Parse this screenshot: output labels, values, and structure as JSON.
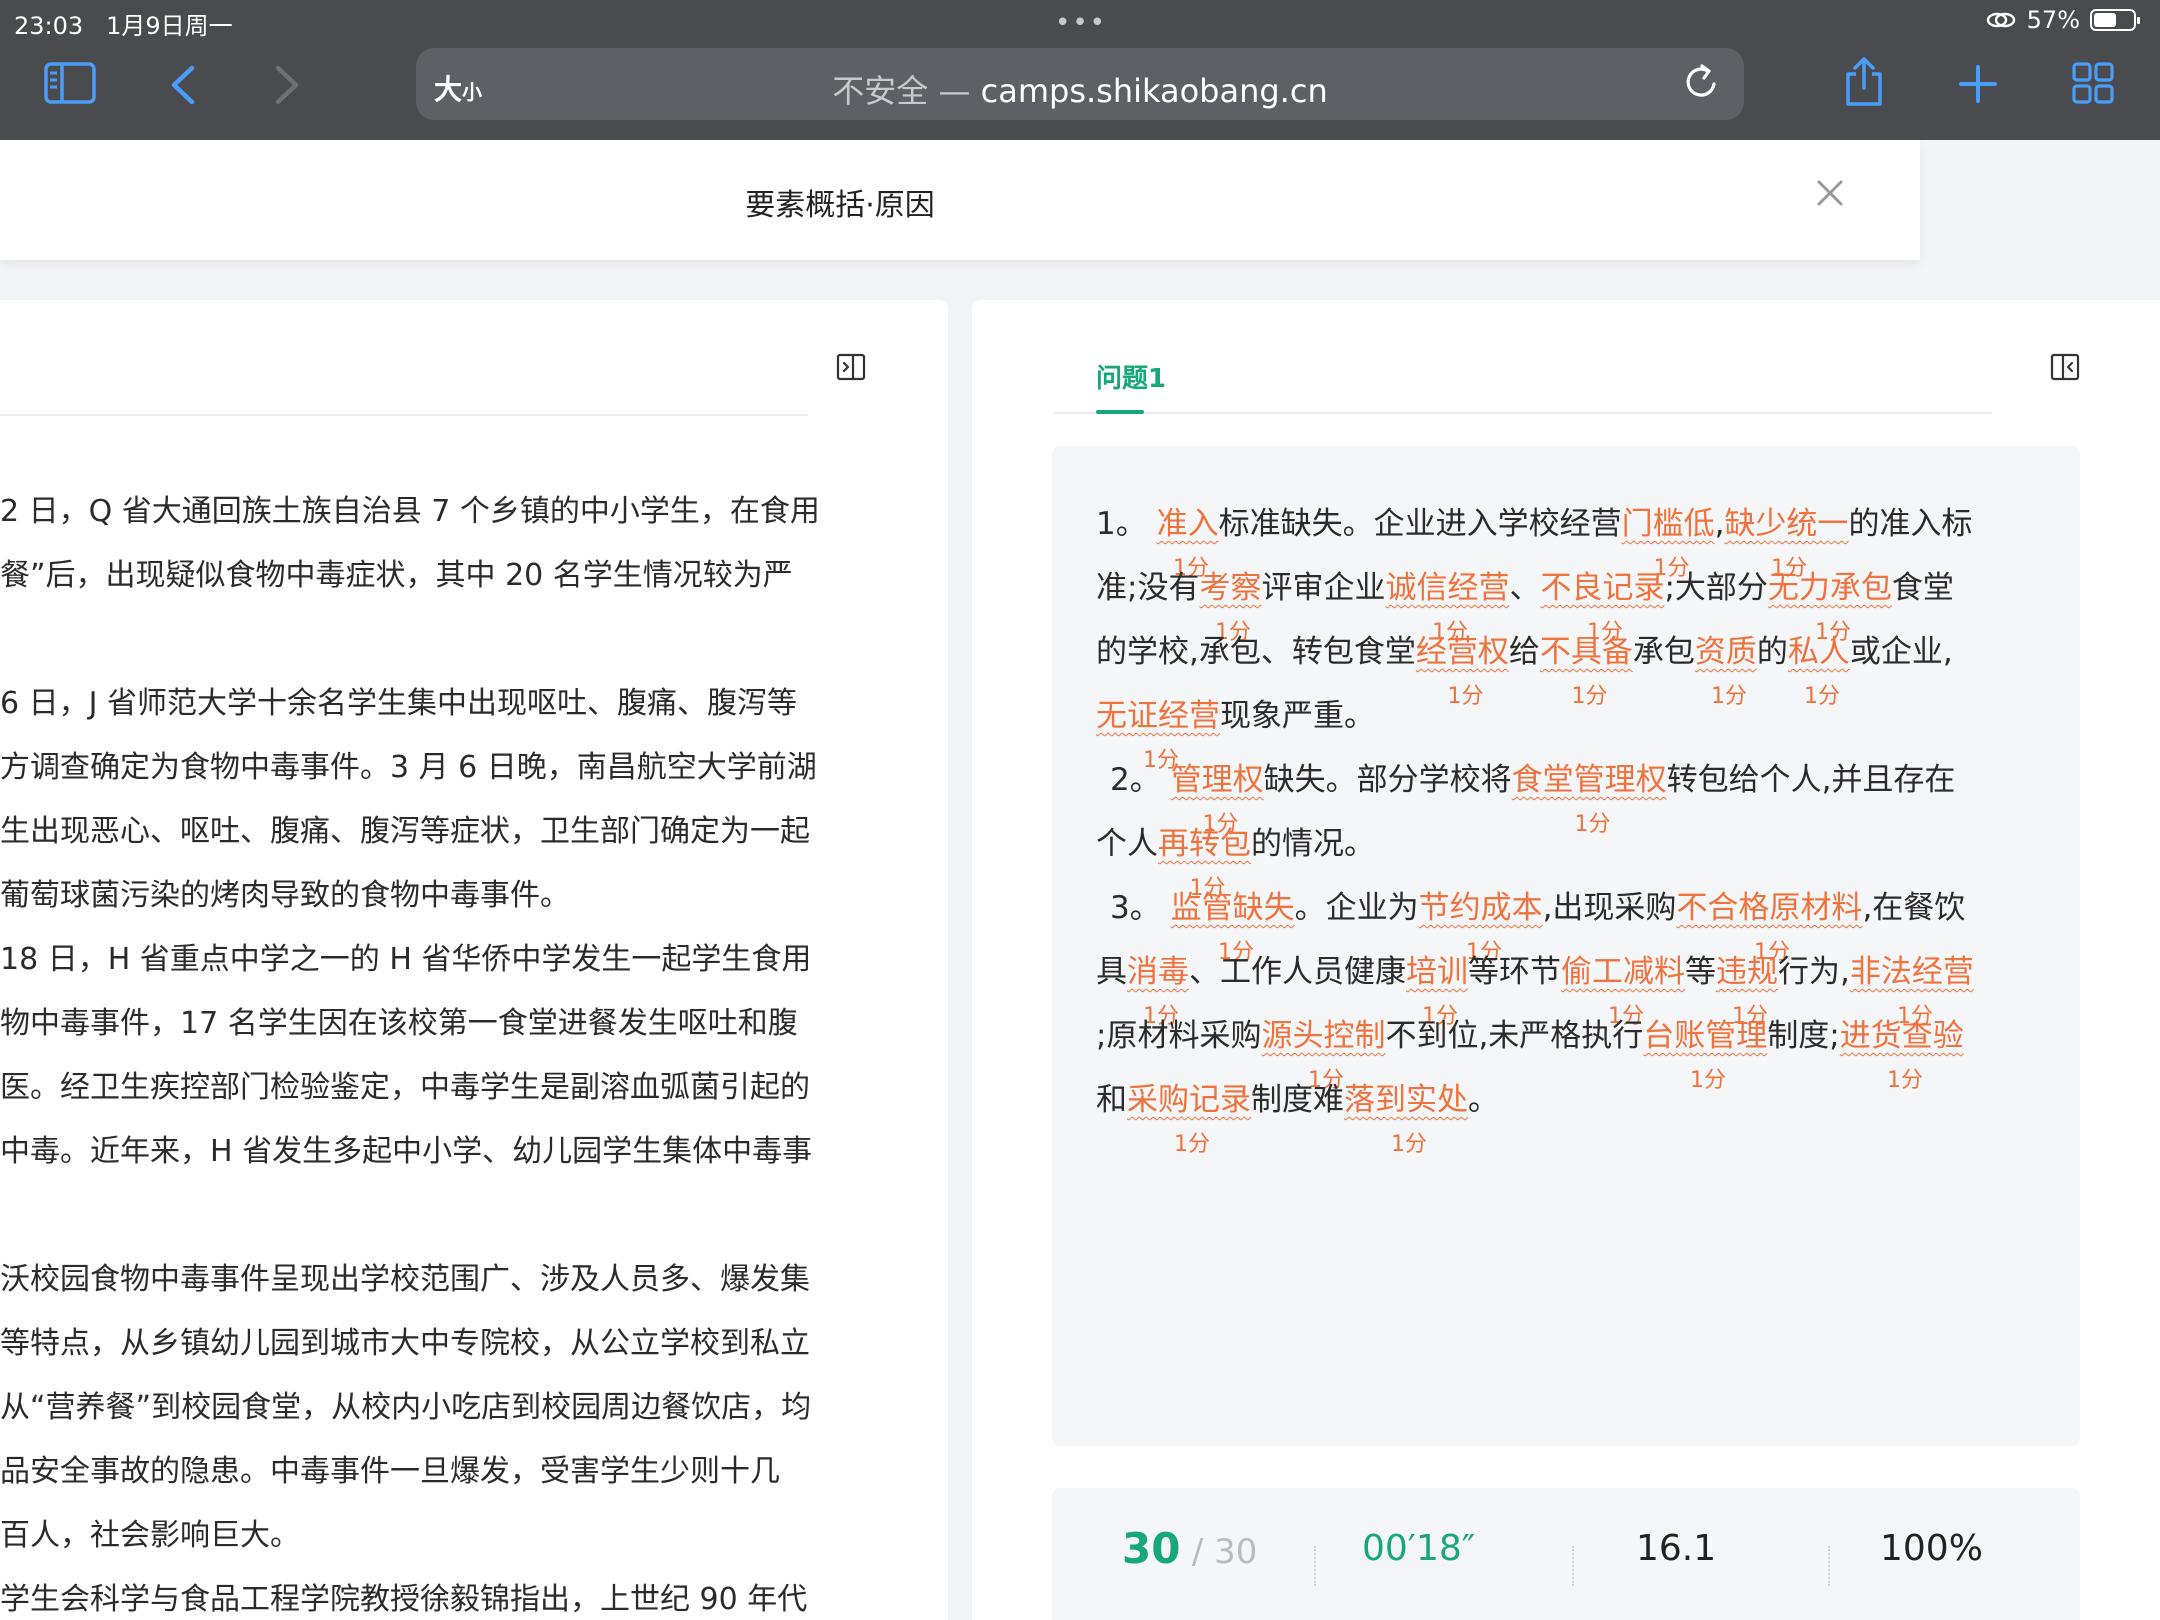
{
  "status_bar": {
    "time": "23:03",
    "date": "1月9日周一",
    "battery": "57%",
    "battery_level": 0.57
  },
  "browser": {
    "aa_big": "大",
    "aa_small": "小",
    "insecure": "不安全 —",
    "domain": "camps.shikaobang.cn",
    "icons": [
      "sidebar-icon",
      "back-icon",
      "forward-icon",
      "reload-icon",
      "share-icon",
      "new-tab-icon",
      "tabs-overview-icon"
    ]
  },
  "header": {
    "title": "要素概括·原因"
  },
  "material": {
    "lines": [
      "2 日，Q 省大通回族土族自治县 7 个乡镇的中小学生，在食用",
      "餐”后，出现疑似食物中毒症状，其中 20 名学生情况较为严",
      "",
      "6 日，J 省师范大学十余名学生集中出现呕吐、腹痛、腹泻等",
      "方调查确定为食物中毒事件。3 月 6 日晚，南昌航空大学前湖",
      "生出现恶心、呕吐、腹痛、腹泻等症状，卫生部门确定为一起",
      "葡萄球菌污染的烤肉导致的食物中毒事件。",
      " 18 日，H 省重点中学之一的 H 省华侨中学发生一起学生食用",
      "物中毒事件，17 名学生因在该校第一食堂进餐发生呕吐和腹",
      "医。经卫生疾控部门检验鉴定，中毒学生是副溶血弧菌引起的",
      "中毒。近年来，H 省发生多起中小学、幼儿园学生集体中毒事",
      "",
      "沃校园食物中毒事件呈现出学校范围广、涉及人员多、爆发集",
      "等特点，从乡镇幼儿园到城市大中专院校，从公立学校到私立",
      "从“营养餐”到校园食堂，从校内小吃店到校园周边餐饮店，均",
      "品安全事故的隐患。中毒事件一旦爆发，受害学生少则十几",
      "百人，社会影响巨大。",
      "学生会科学与食品工程学院教授徐毅锦指出，上世纪 90 年代"
    ]
  },
  "question": {
    "tab_label": "问题1",
    "score_label": "1分",
    "answer_lines": [
      [
        [
          "t",
          "1。 "
        ],
        [
          "k",
          "准入"
        ],
        [
          "t",
          "标准缺失。企业进入学校经营"
        ],
        [
          "k",
          "门槛低"
        ],
        [
          "t",
          ","
        ],
        [
          "k",
          "缺少统一"
        ],
        [
          "t",
          "的准入标"
        ]
      ],
      [
        [
          "t",
          "准;没有"
        ],
        [
          "k",
          "考察"
        ],
        [
          "t",
          "评审企业"
        ],
        [
          "k",
          "诚信经营"
        ],
        [
          "t",
          "、"
        ],
        [
          "k",
          "不良记录"
        ],
        [
          "t",
          ";大部分"
        ],
        [
          "k",
          "无力承包"
        ],
        [
          "t",
          "食堂"
        ]
      ],
      [
        [
          "t",
          "的学校,承包、转包食堂"
        ],
        [
          "k",
          "经营权"
        ],
        [
          "t",
          "给"
        ],
        [
          "k",
          "不具备"
        ],
        [
          "t",
          "承包"
        ],
        [
          "k",
          "资质"
        ],
        [
          "t",
          "的"
        ],
        [
          "k",
          "私人"
        ],
        [
          "t",
          "或企业,"
        ]
      ],
      [
        [
          "k",
          "无证经营"
        ],
        [
          "t",
          "现象严重。"
        ]
      ],
      [
        [
          "t",
          "2。 "
        ],
        [
          "k",
          "管理权"
        ],
        [
          "t",
          "缺失。部分学校将"
        ],
        [
          "k",
          "食堂管理权"
        ],
        [
          "t",
          "转包给个人,并且存在"
        ]
      ],
      [
        [
          "t",
          "个人"
        ],
        [
          "k",
          "再转包"
        ],
        [
          "t",
          "的情况。"
        ]
      ],
      [
        [
          "t",
          "3。 "
        ],
        [
          "k",
          "监管缺失"
        ],
        [
          "t",
          "。企业为"
        ],
        [
          "k",
          "节约成本"
        ],
        [
          "t",
          ",出现采购"
        ],
        [
          "k",
          "不合格原材料"
        ],
        [
          "t",
          ",在餐饮"
        ]
      ],
      [
        [
          "t",
          "具"
        ],
        [
          "k",
          "消毒"
        ],
        [
          "t",
          "、工作人员健康"
        ],
        [
          "k",
          "培训"
        ],
        [
          "t",
          "等环节"
        ],
        [
          "k",
          "偷工减料"
        ],
        [
          "t",
          "等"
        ],
        [
          "k",
          "违规"
        ],
        [
          "t",
          "行为,"
        ],
        [
          "k",
          "非法经营"
        ]
      ],
      [
        [
          "t",
          ";原材料采购"
        ],
        [
          "k",
          "源头控制"
        ],
        [
          "t",
          "不到位,未严格执行"
        ],
        [
          "k",
          "台账管理"
        ],
        [
          "t",
          "制度;"
        ],
        [
          "k",
          "进货查验"
        ]
      ],
      [
        [
          "t",
          "和"
        ],
        [
          "k",
          "采购记录"
        ],
        [
          "t",
          "制度难"
        ],
        [
          "k",
          "落到实处"
        ],
        [
          "t",
          "。"
        ]
      ]
    ]
  },
  "stats": {
    "score": "30",
    "total": "/ 30",
    "time": "00′18″",
    "speed": "16.1",
    "accuracy": "100%",
    "accent_color": "#18a67b",
    "keyword_color": "#f0723d"
  }
}
